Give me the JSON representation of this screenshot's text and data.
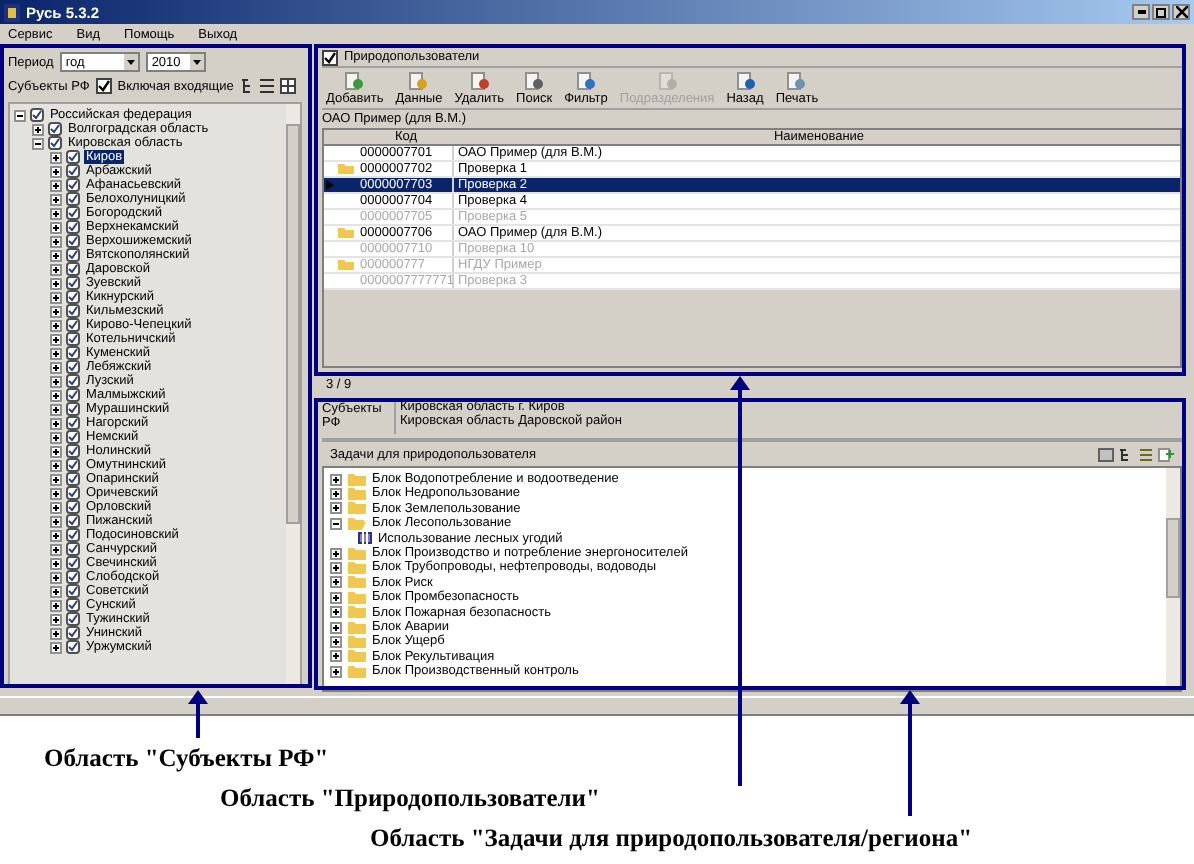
{
  "window": {
    "title": "Русь 5.3.2"
  },
  "menu": [
    "Сервис",
    "Вид",
    "Помощь",
    "Выход"
  ],
  "left_panel": {
    "period_label": "Период",
    "period": "год",
    "year": "2010",
    "subjects_label": "Субъекты РФ",
    "include_nested": {
      "label": "Включая входящие",
      "checked": true
    },
    "tree": [
      {
        "label": "Российская федерация",
        "expanded": true,
        "selected": false,
        "children": [
          {
            "label": "Волгоградская область",
            "expanded": false,
            "selected": false
          },
          {
            "label": "Кировская область",
            "expanded": true,
            "selected": false,
            "children": [
              {
                "label": "Киров",
                "expanded": false,
                "selected": true
              },
              {
                "label": "Арбажский",
                "expanded": false,
                "selected": false
              },
              {
                "label": "Афанасьевский",
                "expanded": false,
                "selected": false
              },
              {
                "label": "Белохолуницкий",
                "expanded": false,
                "selected": false
              },
              {
                "label": "Богородский",
                "expanded": false,
                "selected": false
              },
              {
                "label": "Верхнекамский",
                "expanded": false,
                "selected": false
              },
              {
                "label": "Верхошижемский",
                "expanded": false,
                "selected": false
              },
              {
                "label": "Вятскополянский",
                "expanded": false,
                "selected": false
              },
              {
                "label": "Даровской",
                "expanded": false,
                "selected": false
              },
              {
                "label": "Зуевский",
                "expanded": false,
                "selected": false
              },
              {
                "label": "Кикнурский",
                "expanded": false,
                "selected": false
              },
              {
                "label": "Кильмезский",
                "expanded": false,
                "selected": false
              },
              {
                "label": "Кирово-Чепецкий",
                "expanded": false,
                "selected": false
              },
              {
                "label": "Котельничский",
                "expanded": false,
                "selected": false
              },
              {
                "label": "Куменский",
                "expanded": false,
                "selected": false
              },
              {
                "label": "Лебяжский",
                "expanded": false,
                "selected": false
              },
              {
                "label": "Лузский",
                "expanded": false,
                "selected": false
              },
              {
                "label": "Малмыжский",
                "expanded": false,
                "selected": false
              },
              {
                "label": "Мурашинский",
                "expanded": false,
                "selected": false
              },
              {
                "label": "Нагорский",
                "expanded": false,
                "selected": false
              },
              {
                "label": "Немский",
                "expanded": false,
                "selected": false
              },
              {
                "label": "Нолинский",
                "expanded": false,
                "selected": false
              },
              {
                "label": "Омутнинский",
                "expanded": false,
                "selected": false
              },
              {
                "label": "Опаринский",
                "expanded": false,
                "selected": false
              },
              {
                "label": "Оричевский",
                "expanded": false,
                "selected": false
              },
              {
                "label": "Орловский",
                "expanded": false,
                "selected": false
              },
              {
                "label": "Пижанский",
                "expanded": false,
                "selected": false
              },
              {
                "label": "Подосиновский",
                "expanded": false,
                "selected": false
              },
              {
                "label": "Санчурский",
                "expanded": false,
                "selected": false
              },
              {
                "label": "Свечинский",
                "expanded": false,
                "selected": false
              },
              {
                "label": "Слободской",
                "expanded": false,
                "selected": false
              },
              {
                "label": "Советский",
                "expanded": false,
                "selected": false
              },
              {
                "label": "Сунский",
                "expanded": false,
                "selected": false
              },
              {
                "label": "Тужинский",
                "expanded": false,
                "selected": false
              },
              {
                "label": "Унинский",
                "expanded": false,
                "selected": false
              },
              {
                "label": "Уржумский",
                "expanded": false,
                "selected": false
              }
            ]
          }
        ]
      }
    ]
  },
  "users_panel": {
    "title": "Природопользователи",
    "checked": true,
    "toolbar": [
      {
        "label": "Добавить",
        "disabled": false
      },
      {
        "label": "Данные",
        "disabled": false
      },
      {
        "label": "Удалить",
        "disabled": false
      },
      {
        "label": "Поиск",
        "disabled": false
      },
      {
        "label": "Фильтр",
        "disabled": false
      },
      {
        "label": "Подразделения",
        "disabled": true
      },
      {
        "label": "Назад",
        "disabled": false
      },
      {
        "label": "Печать",
        "disabled": false
      }
    ],
    "caption": "ОАО Пример (для В.М.)",
    "columns": [
      "Код",
      "Наименование"
    ],
    "rows": [
      {
        "code": "0000007701",
        "name": "ОАО Пример (для В.М.)",
        "folder": false,
        "inactive": false,
        "selected": false
      },
      {
        "code": "0000007702",
        "name": "Проверка 1",
        "folder": true,
        "inactive": false,
        "selected": false
      },
      {
        "code": "0000007703",
        "name": "Проверка 2",
        "folder": false,
        "inactive": false,
        "selected": true
      },
      {
        "code": "0000007704",
        "name": "Проверка 4",
        "folder": false,
        "inactive": false,
        "selected": false
      },
      {
        "code": "0000007705",
        "name": "Проверка 5",
        "folder": false,
        "inactive": true,
        "selected": false
      },
      {
        "code": "0000007706",
        "name": "ОАО Пример (для В.М.)",
        "folder": true,
        "inactive": false,
        "selected": false
      },
      {
        "code": "0000007710",
        "name": "Проверка 10",
        "folder": false,
        "inactive": true,
        "selected": false
      },
      {
        "code": "000000777",
        "name": "НГДУ Пример",
        "folder": true,
        "inactive": true,
        "selected": false
      },
      {
        "code": "0000007777771",
        "name": "Проверка 3",
        "folder": false,
        "inactive": true,
        "selected": false
      }
    ],
    "counter": "3 / 9"
  },
  "subjects_panel": {
    "label": "Субъекты РФ",
    "items": [
      "Кировская область г. Киров",
      "Кировская область Даровской район"
    ]
  },
  "tasks_panel": {
    "title": "Задачи для природопользователя",
    "tree": [
      {
        "label": "Блок Водопотребление и водоотведение",
        "expanded": false
      },
      {
        "label": "Блок Недропользование",
        "expanded": false
      },
      {
        "label": "Блок Землепользование",
        "expanded": false
      },
      {
        "label": "Блок Лесопользование",
        "expanded": true,
        "children": [
          {
            "label": "Использование лесных угодий"
          }
        ]
      },
      {
        "label": "Блок Производство и потребление энергоносителей",
        "expanded": false
      },
      {
        "label": "Блок Трубопроводы, нефтепроводы, водоводы",
        "expanded": false
      },
      {
        "label": "Блок Риск",
        "expanded": false
      },
      {
        "label": "Блок Промбезопасность",
        "expanded": false
      },
      {
        "label": "Блок Пожарная безопасность",
        "expanded": false
      },
      {
        "label": "Блок Аварии",
        "expanded": false
      },
      {
        "label": "Блок Ущерб",
        "expanded": false
      },
      {
        "label": "Блок Рекультивация",
        "expanded": false
      },
      {
        "label": "Блок Производственный контроль",
        "expanded": false
      }
    ]
  },
  "annotations": [
    "Область \"Субъекты РФ\"",
    "Область \"Природопользователи\"",
    "Область \"Задачи для природопользователя/региона\""
  ]
}
